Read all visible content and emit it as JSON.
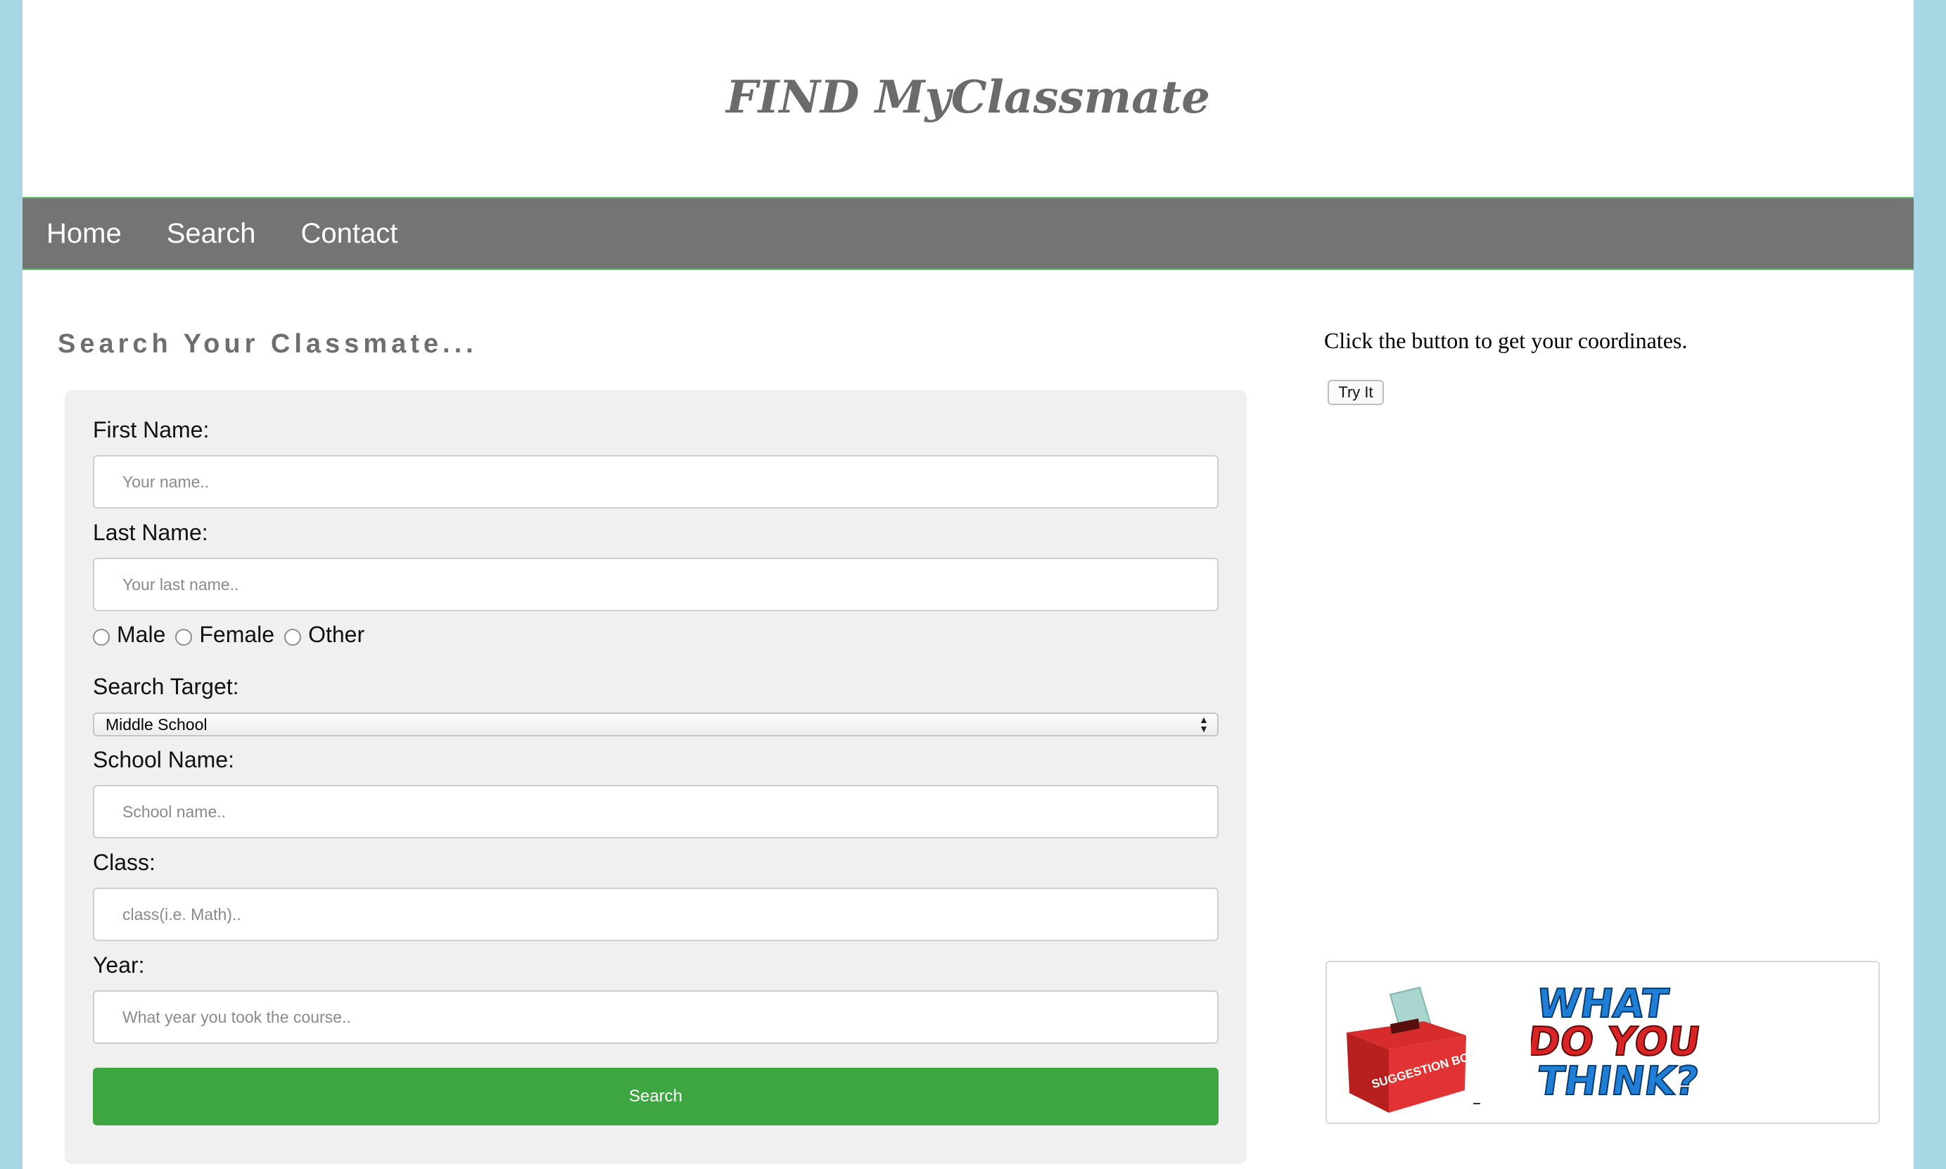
{
  "header": {
    "title": "FIND MyClassmate"
  },
  "nav": {
    "items": [
      "Home",
      "Search",
      "Contact"
    ]
  },
  "main": {
    "heading": "Search Your Classmate..."
  },
  "form": {
    "first_name_label": "First Name:",
    "first_name_placeholder": "Your name..",
    "last_name_label": "Last Name:",
    "last_name_placeholder": "Your last name..",
    "gender_options": [
      "Male",
      "Female",
      "Other"
    ],
    "search_target_label": "Search Target:",
    "search_target_value": "Middle School",
    "school_name_label": "School Name:",
    "school_name_placeholder": "School name..",
    "class_label": "Class:",
    "class_placeholder": "class(i.e. Math)..",
    "year_label": "Year:",
    "year_placeholder": "What year you took the course..",
    "search_button": "Search"
  },
  "sidebar": {
    "coords_text": "Click the button to get your coordinates.",
    "try_button": "Try It",
    "suggestion_box_text": "SUGGESTION BOX",
    "what_do_you_think_lines": [
      "WHAT",
      "DO YOU",
      "THINK?"
    ]
  },
  "colors": {
    "background": "#a7d6e5",
    "nav": "#747474",
    "nav_border": "#5fbf6a",
    "button": "#3da640",
    "panel": "#f0f0f0"
  }
}
